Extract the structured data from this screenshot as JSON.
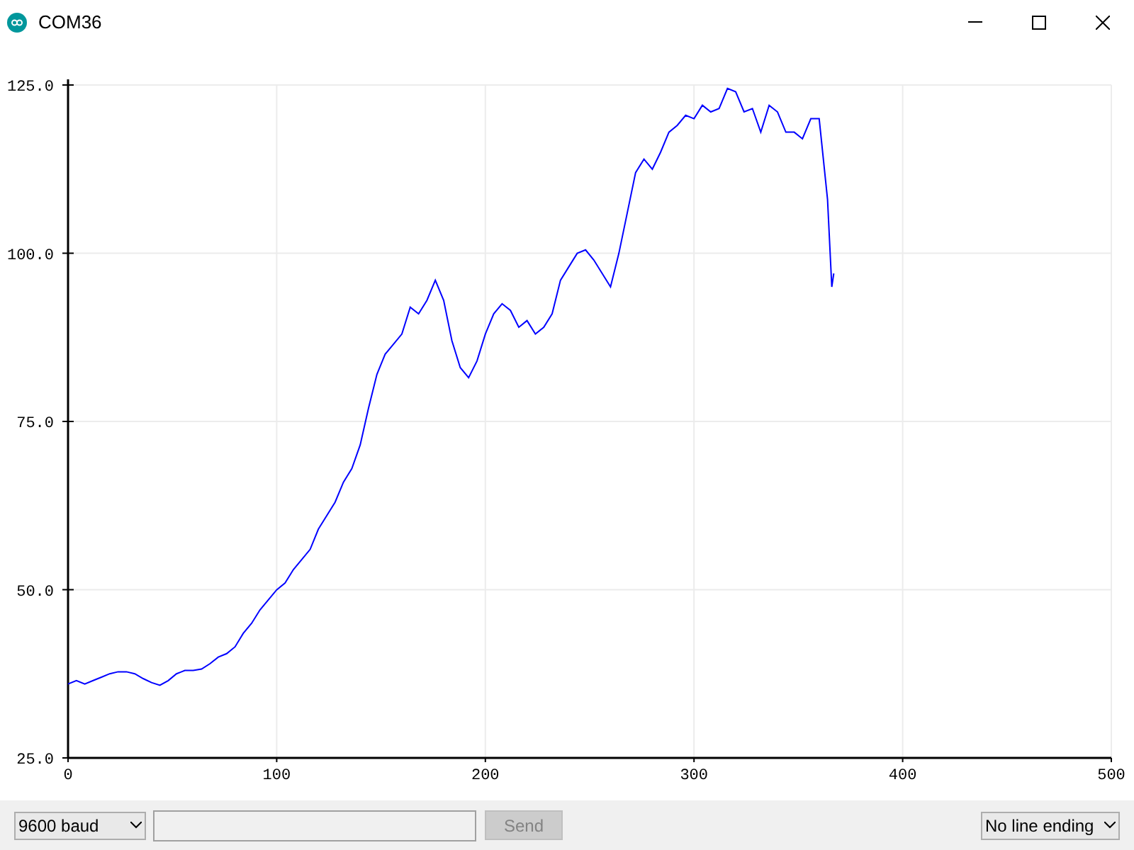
{
  "window": {
    "title": "COM36"
  },
  "plot": {
    "chart_data": {
      "type": "line",
      "x": [
        0,
        4,
        8,
        12,
        16,
        20,
        24,
        28,
        32,
        36,
        40,
        44,
        48,
        52,
        56,
        60,
        64,
        68,
        72,
        76,
        80,
        84,
        88,
        92,
        96,
        100,
        104,
        108,
        112,
        116,
        120,
        124,
        128,
        132,
        136,
        140,
        144,
        148,
        152,
        156,
        160,
        164,
        168,
        172,
        176,
        180,
        184,
        188,
        192,
        196,
        200,
        204,
        208,
        212,
        216,
        220,
        224,
        228,
        232,
        236,
        240,
        244,
        248,
        252,
        256,
        260,
        264,
        268,
        272,
        276,
        280,
        284,
        288,
        292,
        296,
        300,
        304,
        308,
        312,
        316,
        320,
        324,
        328,
        332,
        336,
        340,
        344,
        348,
        352,
        356,
        360,
        364,
        366,
        367
      ],
      "series": [
        {
          "color": "#0000ff",
          "values": [
            36,
            36.5,
            36,
            36.5,
            37,
            37.5,
            37.8,
            37.8,
            37.5,
            36.8,
            36.2,
            35.8,
            36.5,
            37.5,
            38,
            38,
            38.2,
            39,
            40,
            40.5,
            41.5,
            43.5,
            45,
            47,
            48.5,
            50,
            51,
            53,
            54.5,
            56,
            59,
            61,
            63,
            66,
            68,
            71.5,
            77,
            82,
            85,
            86.5,
            88,
            92,
            91,
            93,
            96,
            93,
            87,
            83,
            81.5,
            84,
            88,
            91,
            92.5,
            91.5,
            89,
            90,
            88,
            89,
            91,
            96,
            98,
            100,
            100.5,
            99,
            97,
            95,
            100,
            106,
            112,
            114,
            112.5,
            115,
            118,
            119,
            120.5,
            120,
            122,
            121,
            121.5,
            124.5,
            124,
            121,
            121.5,
            118,
            122,
            121,
            118,
            118,
            117,
            120,
            120,
            108,
            95,
            97
          ]
        }
      ],
      "grid": true,
      "xlim": [
        0,
        500
      ],
      "ylim": [
        25,
        125
      ],
      "xticks": [
        0,
        100,
        200,
        300,
        400,
        500
      ],
      "yticks": [
        {
          "value": 25,
          "label": "25.0"
        },
        {
          "value": 50,
          "label": "50.0"
        },
        {
          "value": 75,
          "label": "75.0"
        },
        {
          "value": 100,
          "label": "100.0"
        },
        {
          "value": 125,
          "label": "125.0"
        }
      ]
    }
  },
  "bottom_bar": {
    "baud": "9600 baud",
    "send": {
      "label": "Send",
      "disabled": true
    },
    "line_ending": "No line ending"
  }
}
